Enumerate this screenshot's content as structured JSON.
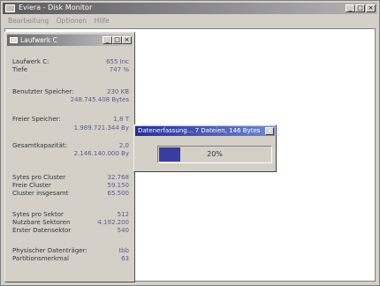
{
  "main_window": {
    "title": "Eviera - Disk Monitor",
    "menu": [
      "Bearbeitung",
      "Optionen",
      "Hilfe"
    ],
    "controls": {
      "minimize": "_",
      "maximize": "□",
      "close": "×"
    }
  },
  "drive_window": {
    "title": "Laufwerk C",
    "controls": {
      "minimize": "_",
      "maximize": "□",
      "close": "×"
    },
    "drive_label": "Laufwerk C:",
    "drive_value": "655 Inc",
    "depth_label": "Tiefe",
    "depth_value": "747 %",
    "used_label": "Benutzter Speicher:",
    "used_value": "230 KB",
    "used_bytes": "248.745.408 Bytes",
    "free_label": "Freier Speicher:",
    "free_value": "1,8 T",
    "free_bytes": "1.989.721.344 By",
    "capacity_label": "Gesamtkapazität:",
    "capacity_value": "2,0",
    "capacity_bytes": "2.146.140.000 By",
    "sectors_per_cluster_label": "Sytes pro Cluster",
    "sectors_per_cluster_value": "32.768",
    "free_clusters_label": "Freie Cluster",
    "free_clusters_value": "59.150",
    "clusters_total_label": "Cluster insgesamt",
    "clusters_total_value": "65.500",
    "bytes_per_sector_label": "Sytes pro Sektor",
    "bytes_per_sector_value": "512",
    "usable_sectors_label": "Nutzbare Sektoren",
    "usable_sectors_value": "4.192.200",
    "first_data_sector_label": "Erster Datensektor",
    "first_data_sector_value": "540",
    "physical_carrier_label": "Physischer Datenträger:",
    "physical_carrier_value": "tbb",
    "partition_label": "Partitionsmerkmal",
    "partition_value": "63"
  },
  "progress_dialog": {
    "title": "Datenerfassung... 7 Dateien, 146 Bytes",
    "close": "×",
    "percent": 20,
    "percent_label": "20%"
  },
  "colors": {
    "dialog_title_start": "#232f9a",
    "dialog_title_end": "#6f86d4",
    "progress_fill": "#3a3c9e",
    "value_text": "#5a5a8c"
  }
}
